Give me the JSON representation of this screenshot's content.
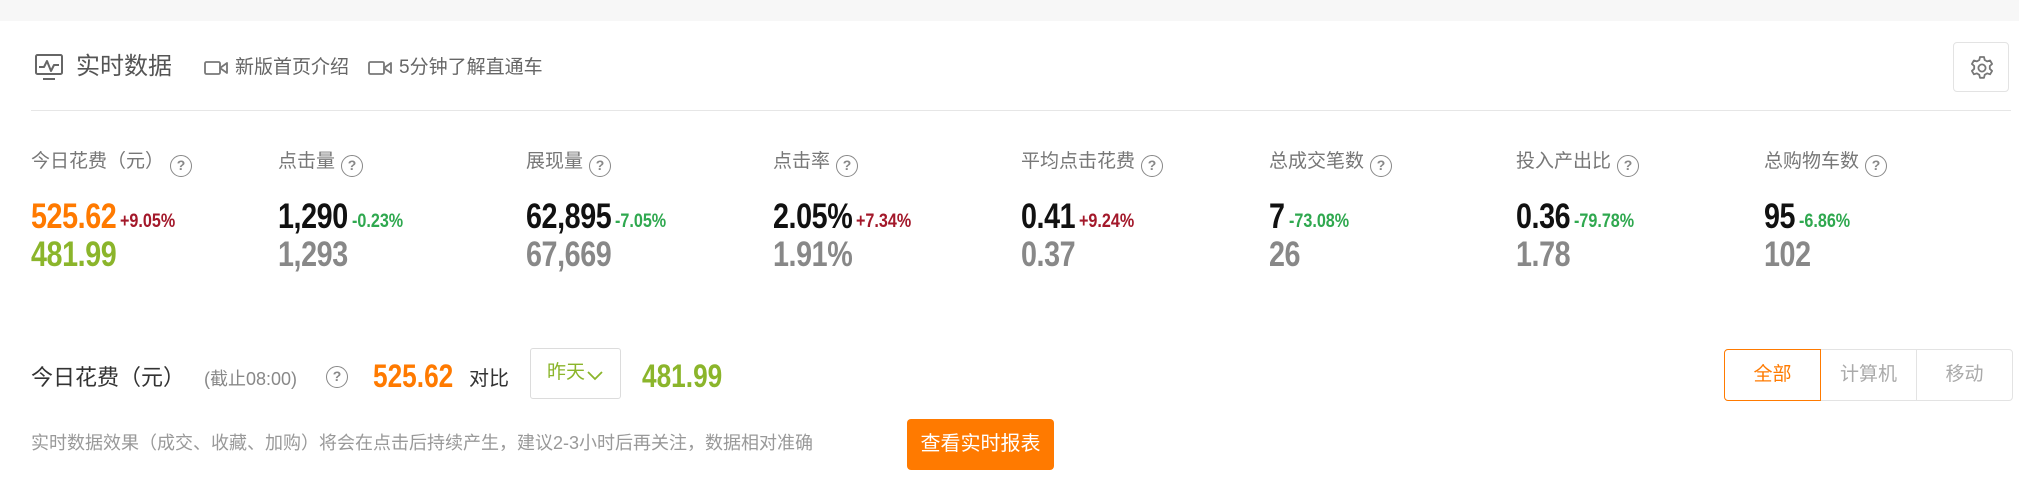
{
  "header": {
    "title": "实时数据",
    "links": [
      "新版首页介绍",
      "5分钟了解直通车"
    ]
  },
  "metrics": [
    {
      "label": "今日花费（元）",
      "value": "525.62",
      "delta": "+9.05%",
      "trend": "up",
      "compare": "481.99",
      "highlight": true
    },
    {
      "label": "点击量",
      "value": "1,290",
      "delta": "-0.23%",
      "trend": "down",
      "compare": "1,293"
    },
    {
      "label": "展现量",
      "value": "62,895",
      "delta": "-7.05%",
      "trend": "down",
      "compare": "67,669"
    },
    {
      "label": "点击率",
      "value": "2.05%",
      "delta": "+7.34%",
      "trend": "up",
      "compare": "1.91%"
    },
    {
      "label": "平均点击花费",
      "value": "0.41",
      "delta": "+9.24%",
      "trend": "up",
      "compare": "0.37"
    },
    {
      "label": "总成交笔数",
      "value": "7",
      "delta": "-73.08%",
      "trend": "down",
      "compare": "26"
    },
    {
      "label": "投入产出比",
      "value": "0.36",
      "delta": "-79.78%",
      "trend": "down",
      "compare": "1.78"
    },
    {
      "label": "总购物车数",
      "value": "95",
      "delta": "-6.86%",
      "trend": "down",
      "compare": "102"
    }
  ],
  "spend": {
    "label": "今日花费（元）",
    "cutoff": "(截止08:00)",
    "value": "525.62",
    "compare_label": "对比",
    "compare_select": "昨天",
    "compare_value": "481.99"
  },
  "device_tabs": [
    {
      "label": "全部",
      "active": true
    },
    {
      "label": "计算机",
      "active": false
    },
    {
      "label": "移动",
      "active": false
    }
  ],
  "notice": "实时数据效果（成交、收藏、加购）将会在点击后持续产生，建议2-3小时后再关注，数据相对准确",
  "report_button": "查看实时报表",
  "colors": {
    "accent": "#ff7a00",
    "compare_green": "#8bb52b",
    "trend_up": "#a3182a",
    "trend_down": "#2fa84f",
    "compare_gray": "#888888"
  }
}
